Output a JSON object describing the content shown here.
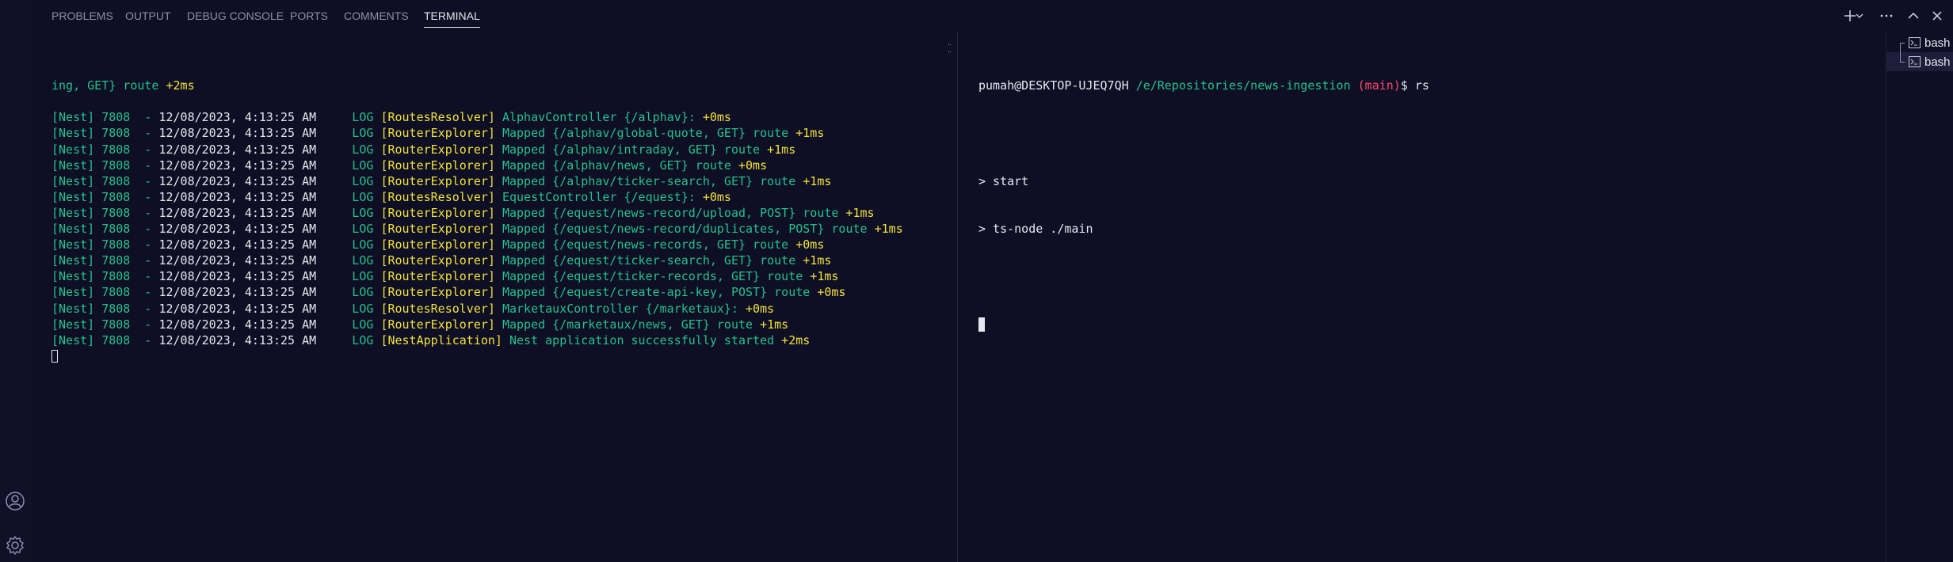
{
  "tabs": [
    {
      "label": "Problems"
    },
    {
      "label": "Output"
    },
    {
      "label": "Debug Console"
    },
    {
      "label": "Ports"
    },
    {
      "label": "Comments"
    },
    {
      "label": "Terminal"
    }
  ],
  "active_tab": "Terminal",
  "panel_actions": [
    "plus-icon",
    "chevron-down-icon",
    "more-icon",
    "maximize-icon",
    "close-icon"
  ],
  "terminal_left": {
    "first_line": {
      "green": "ing, GET} route ",
      "yellow": "+2ms"
    },
    "lines": [
      {
        "nest": "[Nest] 7808  - ",
        "date": "12/08/2023, 4:13:25 AM",
        "log": "     LOG ",
        "ctx": "[RoutesResolver] ",
        "msg": "AlphavController {/alphav}: ",
        "time": "+0ms"
      },
      {
        "nest": "[Nest] 7808  - ",
        "date": "12/08/2023, 4:13:25 AM",
        "log": "     LOG ",
        "ctx": "[RouterExplorer] ",
        "msg": "Mapped {/alphav/global-quote, GET} route ",
        "time": "+1ms"
      },
      {
        "nest": "[Nest] 7808  - ",
        "date": "12/08/2023, 4:13:25 AM",
        "log": "     LOG ",
        "ctx": "[RouterExplorer] ",
        "msg": "Mapped {/alphav/intraday, GET} route ",
        "time": "+1ms"
      },
      {
        "nest": "[Nest] 7808  - ",
        "date": "12/08/2023, 4:13:25 AM",
        "log": "     LOG ",
        "ctx": "[RouterExplorer] ",
        "msg": "Mapped {/alphav/news, GET} route ",
        "time": "+0ms"
      },
      {
        "nest": "[Nest] 7808  - ",
        "date": "12/08/2023, 4:13:25 AM",
        "log": "     LOG ",
        "ctx": "[RouterExplorer] ",
        "msg": "Mapped {/alphav/ticker-search, GET} route ",
        "time": "+1ms"
      },
      {
        "nest": "[Nest] 7808  - ",
        "date": "12/08/2023, 4:13:25 AM",
        "log": "     LOG ",
        "ctx": "[RoutesResolver] ",
        "msg": "EquestController {/equest}: ",
        "time": "+0ms"
      },
      {
        "nest": "[Nest] 7808  - ",
        "date": "12/08/2023, 4:13:25 AM",
        "log": "     LOG ",
        "ctx": "[RouterExplorer] ",
        "msg": "Mapped {/equest/news-record/upload, POST} route ",
        "time": "+1ms"
      },
      {
        "nest": "[Nest] 7808  - ",
        "date": "12/08/2023, 4:13:25 AM",
        "log": "     LOG ",
        "ctx": "[RouterExplorer] ",
        "msg": "Mapped {/equest/news-record/duplicates, POST} route ",
        "time": "+1ms"
      },
      {
        "nest": "[Nest] 7808  - ",
        "date": "12/08/2023, 4:13:25 AM",
        "log": "     LOG ",
        "ctx": "[RouterExplorer] ",
        "msg": "Mapped {/equest/news-records, GET} route ",
        "time": "+0ms"
      },
      {
        "nest": "[Nest] 7808  - ",
        "date": "12/08/2023, 4:13:25 AM",
        "log": "     LOG ",
        "ctx": "[RouterExplorer] ",
        "msg": "Mapped {/equest/ticker-search, GET} route ",
        "time": "+1ms"
      },
      {
        "nest": "[Nest] 7808  - ",
        "date": "12/08/2023, 4:13:25 AM",
        "log": "     LOG ",
        "ctx": "[RouterExplorer] ",
        "msg": "Mapped {/equest/ticker-records, GET} route ",
        "time": "+1ms"
      },
      {
        "nest": "[Nest] 7808  - ",
        "date": "12/08/2023, 4:13:25 AM",
        "log": "     LOG ",
        "ctx": "[RouterExplorer] ",
        "msg": "Mapped {/equest/create-api-key, POST} route ",
        "time": "+0ms"
      },
      {
        "nest": "[Nest] 7808  - ",
        "date": "12/08/2023, 4:13:25 AM",
        "log": "     LOG ",
        "ctx": "[RoutesResolver] ",
        "msg": "MarketauxController {/marketaux}: ",
        "time": "+0ms"
      },
      {
        "nest": "[Nest] 7808  - ",
        "date": "12/08/2023, 4:13:25 AM",
        "log": "     LOG ",
        "ctx": "[RouterExplorer] ",
        "msg": "Mapped {/marketaux/news, GET} route ",
        "time": "+1ms"
      },
      {
        "nest": "[Nest] 7808  - ",
        "date": "12/08/2023, 4:13:25 AM",
        "log": "     LOG ",
        "ctx": "[NestApplication] ",
        "msg": "Nest application successfully started ",
        "time": "+2ms"
      }
    ]
  },
  "terminal_right": {
    "prompt_user": "pumah@DESKTOP-UJEQ7QH",
    "prompt_path": "/e/Repositories/news-ingestion",
    "prompt_branch": "(main)",
    "prompt_cmd": "$ rs",
    "output": [
      "> start",
      "> ts-node ./main"
    ]
  },
  "terminal_list": [
    {
      "label": "bash"
    },
    {
      "label": "bash"
    }
  ],
  "colors": {
    "background": "#0e0e24",
    "green": "#23c28e",
    "yellow": "#f2e33a",
    "red": "#ff4a6a",
    "text": "#e8e8f0"
  }
}
